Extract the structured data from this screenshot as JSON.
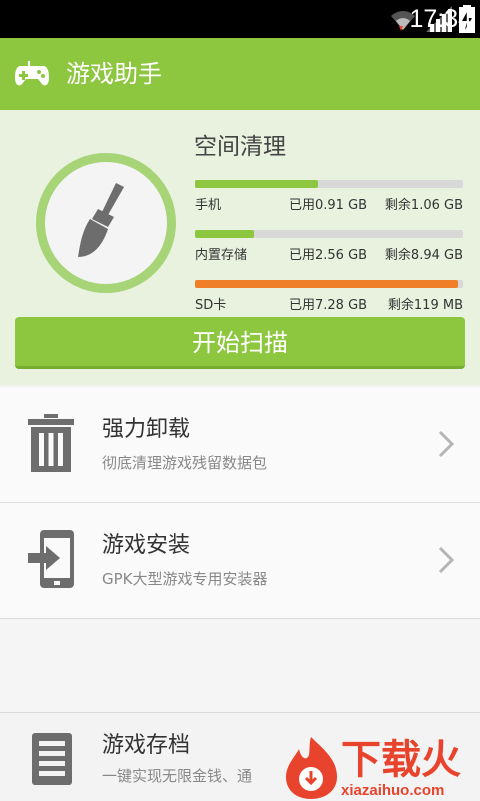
{
  "status_bar": {
    "time": "17:34",
    "icons": [
      "wifi-icon",
      "signal-icon",
      "battery-charging-icon"
    ]
  },
  "app_bar": {
    "title": "游戏助手",
    "icon": "gamepad-icon"
  },
  "clean_panel": {
    "title": "空间清理",
    "storage": [
      {
        "label": "手机",
        "used": "已用0.91 GB",
        "free": "剩余1.06 GB",
        "used_fraction": 0.46,
        "color": "#8dc63f"
      },
      {
        "label": "内置存储",
        "used": "已用2.56 GB",
        "free": "剩余8.94 GB",
        "used_fraction": 0.22,
        "color": "#8dc63f"
      },
      {
        "label": "SD卡",
        "used": "已用7.28 GB",
        "free": "剩余119 MB",
        "used_fraction": 0.98,
        "color": "#f07f2a"
      }
    ],
    "scan_button": "开始扫描",
    "icon": "broom-icon"
  },
  "features": [
    {
      "title": "强力卸载",
      "desc": "彻底清理游戏残留数据包",
      "icon": "trash-icon"
    },
    {
      "title": "游戏安装",
      "desc": "GPK大型游戏专用安装器",
      "icon": "install-icon"
    },
    {
      "title": "游戏存档",
      "desc": "一键实现无限金钱、通",
      "icon": "document-icon"
    }
  ],
  "watermark": {
    "text": "下载火",
    "sub": "xiazaihuo.com"
  },
  "colors": {
    "accent": "#8dc63f",
    "warning": "#f07f2a"
  }
}
